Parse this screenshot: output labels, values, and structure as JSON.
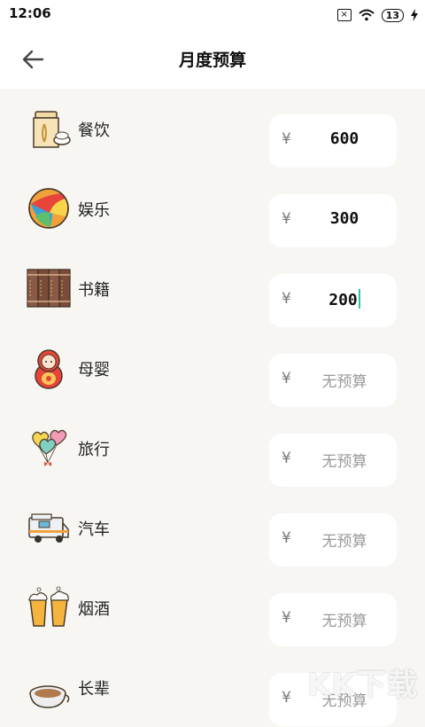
{
  "status_bar": {
    "time": "12:06",
    "sim_icon": "sim-off-icon",
    "wifi_icon": "wifi-icon",
    "battery": "13",
    "charging_icon": "charging-bolt-icon"
  },
  "header": {
    "title": "月度预算",
    "back_icon": "back-arrow-icon"
  },
  "currency_symbol": "¥",
  "categories": [
    {
      "name": "餐饮",
      "icon": "rice-sack-icon",
      "value": "600",
      "placeholder": ""
    },
    {
      "name": "娱乐",
      "icon": "beach-ball-icon",
      "value": "300",
      "placeholder": ""
    },
    {
      "name": "书籍",
      "icon": "books-icon",
      "value": "200",
      "placeholder": "",
      "focused": true
    },
    {
      "name": "母婴",
      "icon": "matryoshka-doll-icon",
      "value": "",
      "placeholder": "无预算"
    },
    {
      "name": "旅行",
      "icon": "heart-balloons-icon",
      "value": "",
      "placeholder": "无预算"
    },
    {
      "name": "汽车",
      "icon": "camper-van-icon",
      "value": "",
      "placeholder": "无预算"
    },
    {
      "name": "烟酒",
      "icon": "beer-mugs-icon",
      "value": "",
      "placeholder": "无预算"
    },
    {
      "name": "长辈",
      "icon": "coffee-cup-icon",
      "value": "",
      "placeholder": "无预算"
    }
  ],
  "watermark": "KK下载",
  "colors": {
    "background": "#f7f6f2",
    "card": "#ffffff",
    "caret": "#2ec4a5"
  }
}
